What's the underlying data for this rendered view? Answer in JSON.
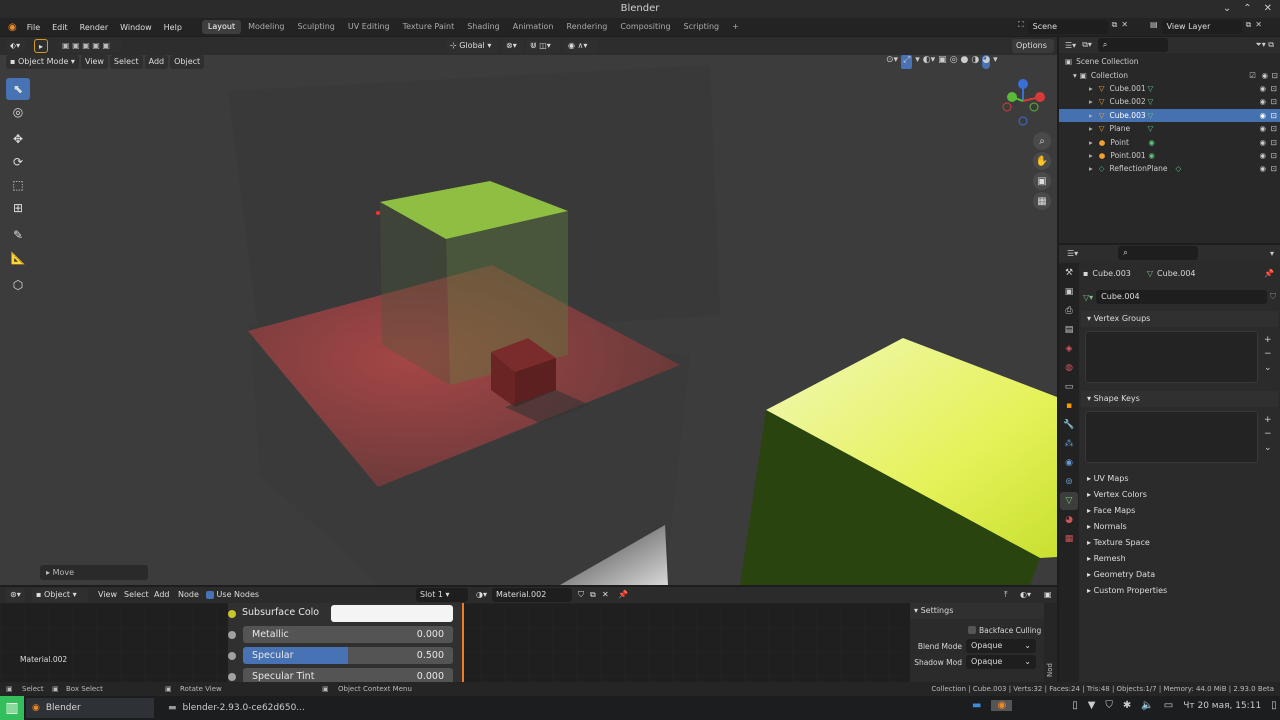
{
  "window": {
    "title": "Blender"
  },
  "menu": {
    "items": [
      "File",
      "Edit",
      "Render",
      "Window",
      "Help"
    ]
  },
  "workspaces": {
    "tabs": [
      "Layout",
      "Modeling",
      "Sculpting",
      "UV Editing",
      "Texture Paint",
      "Shading",
      "Animation",
      "Rendering",
      "Compositing",
      "Scripting"
    ],
    "active": "Layout"
  },
  "top_right": {
    "scene": "Scene",
    "view_layer": "View Layer"
  },
  "viewport_header": {
    "mode": "Object Mode",
    "menus": [
      "View",
      "Select",
      "Add",
      "Object"
    ],
    "transform": "Global",
    "options": "Options"
  },
  "viewport": {
    "operator_panel": "Move"
  },
  "outliner": {
    "root": "Scene Collection",
    "collection": "Collection",
    "items": [
      {
        "name": "Cube.001",
        "type": "mesh",
        "selected": false
      },
      {
        "name": "Cube.002",
        "type": "mesh",
        "selected": false
      },
      {
        "name": "Cube.003",
        "type": "mesh",
        "selected": true
      },
      {
        "name": "Plane",
        "type": "mesh",
        "selected": false
      },
      {
        "name": "Point",
        "type": "light",
        "selected": false
      },
      {
        "name": "Point.001",
        "type": "light",
        "selected": false
      },
      {
        "name": "ReflectionPlane",
        "type": "probe",
        "selected": false
      }
    ]
  },
  "properties": {
    "object": "Cube.003",
    "mesh": "Cube.004",
    "datablock": "Cube.004",
    "panels_open": [
      "Vertex Groups",
      "Shape Keys"
    ],
    "panels_closed": [
      "UV Maps",
      "Vertex Colors",
      "Face Maps",
      "Normals",
      "Texture Space",
      "Remesh",
      "Geometry Data",
      "Custom Properties"
    ]
  },
  "node_editor": {
    "header": {
      "type": "Object",
      "menus": [
        "View",
        "Select",
        "Add",
        "Node"
      ],
      "use_nodes": "Use Nodes",
      "slot": "Slot 1",
      "material": "Material.002"
    },
    "material_label": "Material.002",
    "inputs": [
      {
        "label": "Subsurface Colo",
        "value": "",
        "socket_color": "#c7c729",
        "fill": 1.0,
        "kind": "color"
      },
      {
        "label": "Metallic",
        "value": "0.000",
        "socket_color": "#a1a1a1",
        "fill": 0.0,
        "kind": "slider"
      },
      {
        "label": "Specular",
        "value": "0.500",
        "socket_color": "#a1a1a1",
        "fill": 0.5,
        "kind": "slider"
      },
      {
        "label": "Specular Tint",
        "value": "0.000",
        "socket_color": "#a1a1a1",
        "fill": 0.0,
        "kind": "slider"
      }
    ],
    "settings": {
      "title": "Settings",
      "backface_culling": "Backface Culling",
      "blend_mode_label": "Blend Mode",
      "blend_mode": "Opaque",
      "shadow_mode_label": "Shadow Mod",
      "shadow_mode": "Opaque",
      "side_tab": "Nod"
    }
  },
  "statusbar": {
    "hints": [
      "Select",
      "Box Select",
      "Rotate View",
      "Object Context Menu"
    ],
    "stats": "Collection | Cube.003 | Verts:32 | Faces:24 | Tris:48 | Objects:1/7 | Memory: 44.0 MiB | 2.93.0 Beta"
  },
  "taskbar": {
    "apps": [
      "Blender",
      "blender-2.93.0-ce62d650..."
    ],
    "clock": "Чт 20 мая, 15:11"
  },
  "colors": {
    "accent": "#4772b3",
    "selected_row": "#4671b0",
    "red_plane": "#b84848",
    "green_cube": "#9ed94a",
    "yellow_cube": "#e6f25a"
  }
}
